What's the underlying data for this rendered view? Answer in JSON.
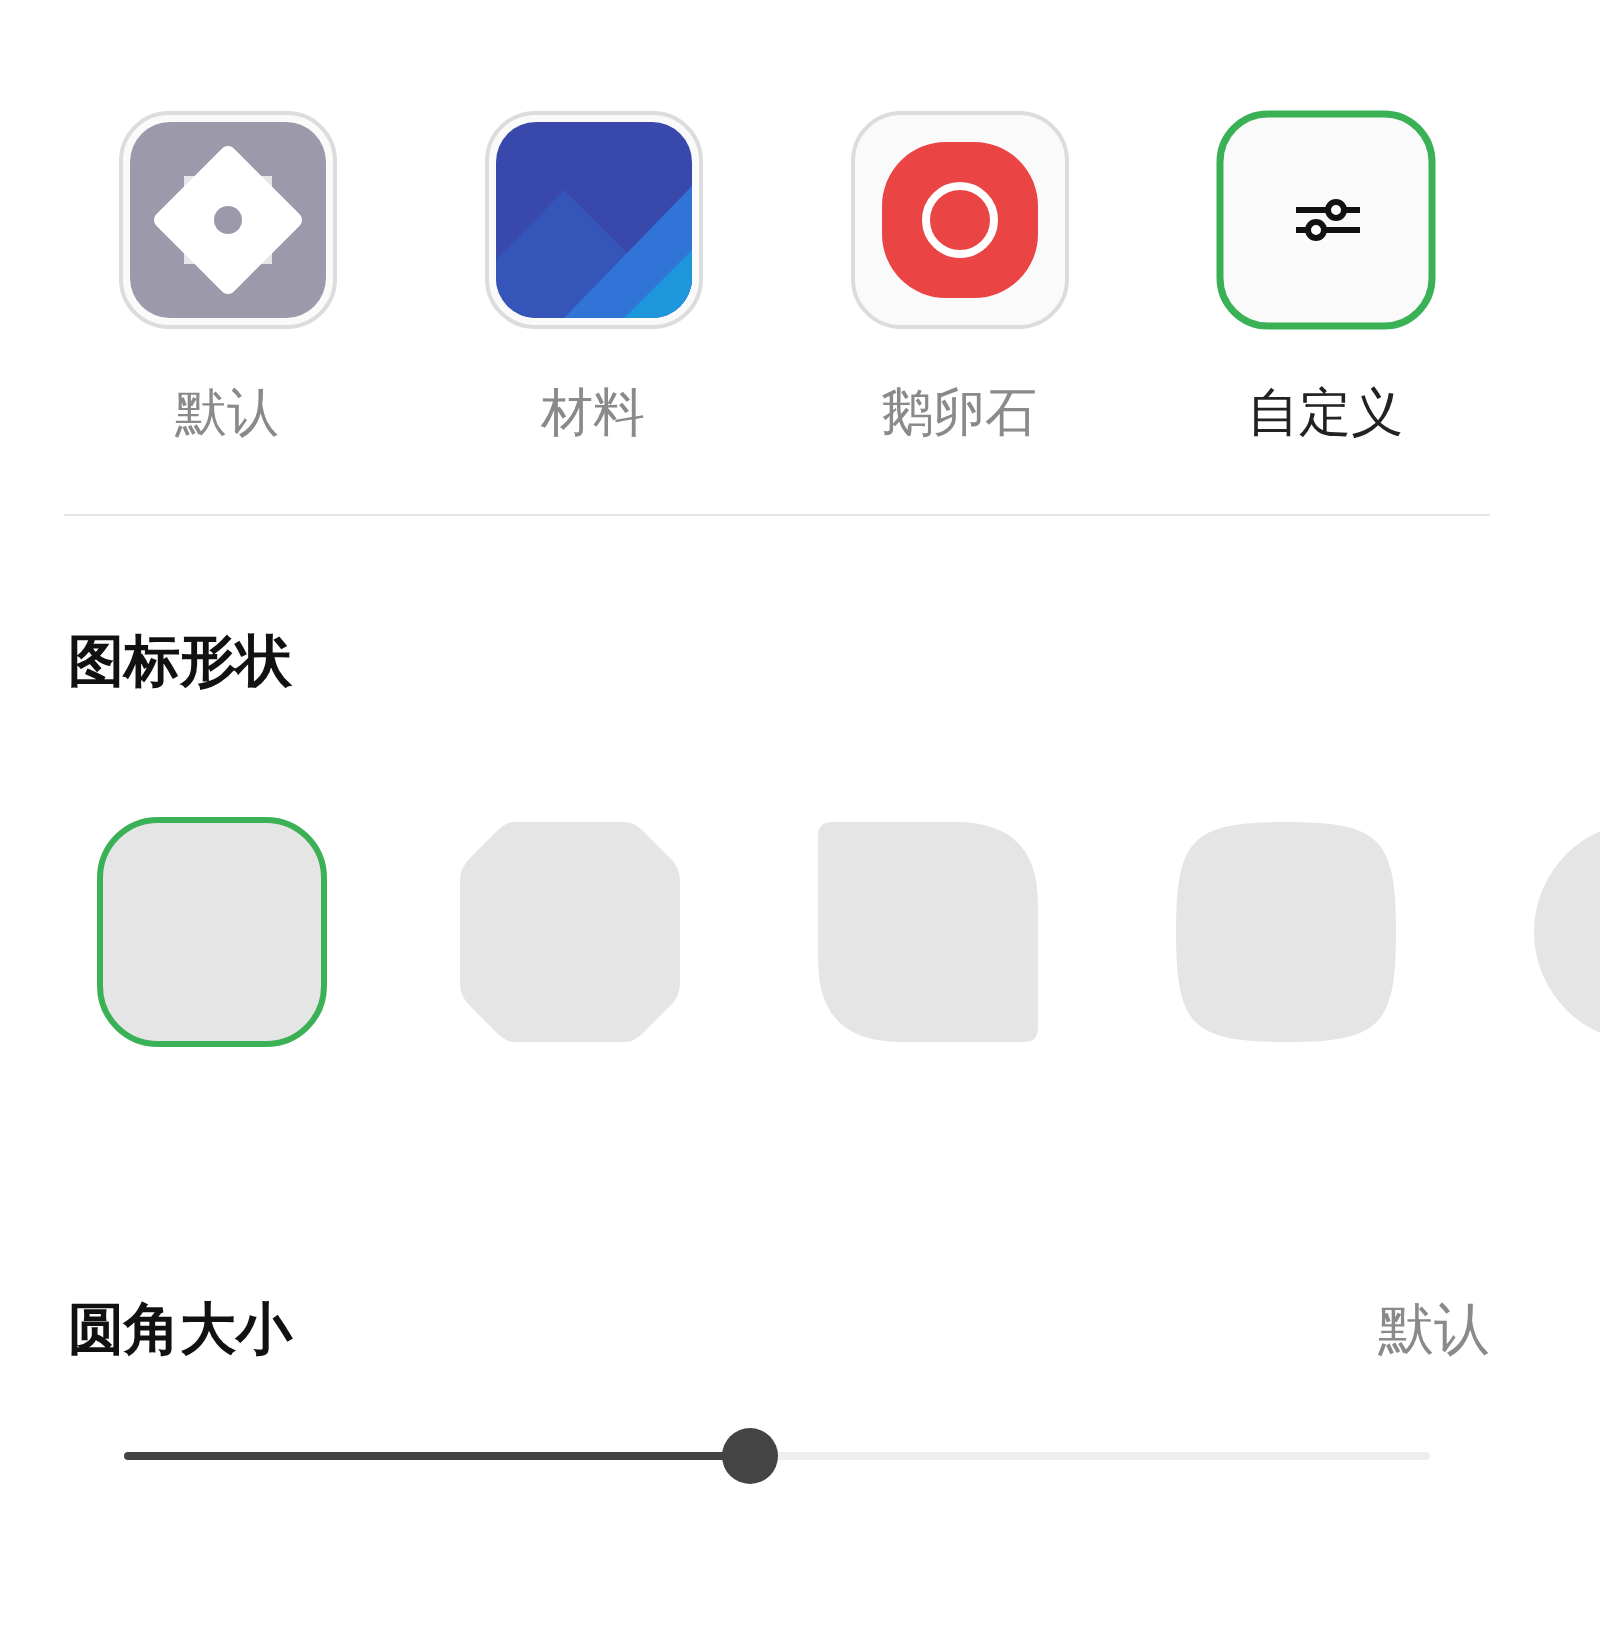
{
  "icon_styles": [
    {
      "label": "默认",
      "kind": "default",
      "selected": false
    },
    {
      "label": "材料",
      "kind": "material",
      "selected": false
    },
    {
      "label": "鹅卵石",
      "kind": "pebble",
      "selected": false
    },
    {
      "label": "自定义",
      "kind": "custom",
      "selected": true
    }
  ],
  "shape_section": {
    "title": "图标形状",
    "shapes": [
      {
        "kind": "rounded",
        "selected": true
      },
      {
        "kind": "octagon",
        "selected": false
      },
      {
        "kind": "leaf",
        "selected": false
      },
      {
        "kind": "squircle",
        "selected": false
      },
      {
        "kind": "circle",
        "selected": false
      }
    ]
  },
  "corner_section": {
    "title": "圆角大小",
    "value": "默认",
    "level": 0.48
  }
}
